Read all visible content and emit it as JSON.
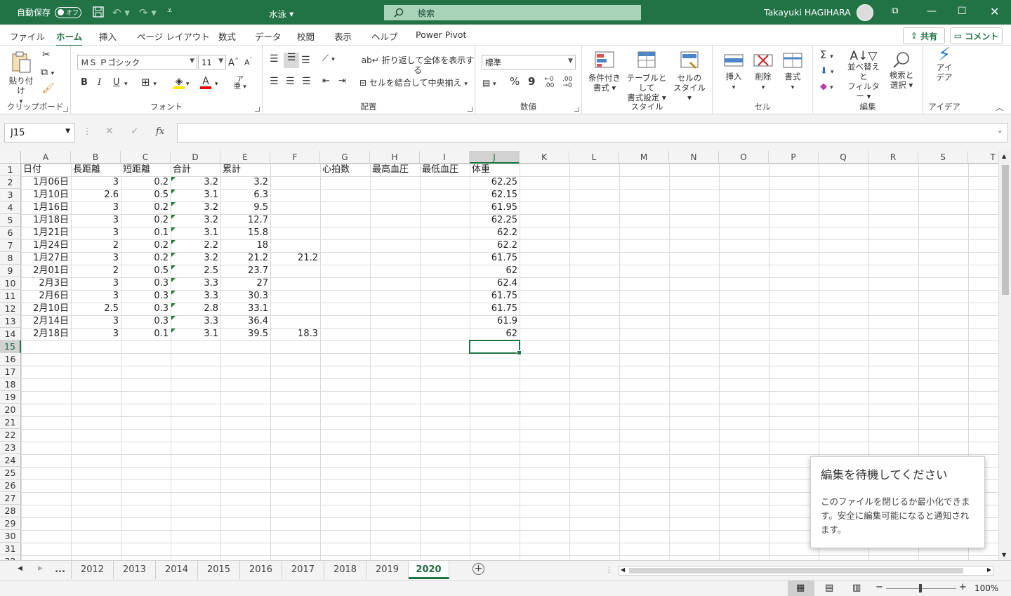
{
  "titlebar": {
    "autosave_label": "自動保存",
    "autosave_state": "オフ",
    "doc_title": "水泳",
    "search_placeholder": "検索",
    "user_name": "Takayuki HAGIHARA"
  },
  "menu": {
    "tabs": [
      "ファイル",
      "ホーム",
      "挿入",
      "ページ レイアウト",
      "数式",
      "データ",
      "校閲",
      "表示",
      "ヘルプ",
      "Power Pivot"
    ],
    "active": "ホーム",
    "share_label": "共有",
    "comment_label": "コメント"
  },
  "ribbon": {
    "clipboard": {
      "paste": "貼り付け",
      "label": "クリップボード"
    },
    "font": {
      "name": "ＭＳ Ｐゴシック",
      "size": "11",
      "label": "フォント",
      "bold": "B",
      "italic": "I",
      "underline": "U"
    },
    "alignment": {
      "wrap": "折り返して全体を表示する",
      "merge": "セルを結合して中央揃え",
      "label": "配置"
    },
    "number": {
      "format": "標準",
      "percent": "%",
      "comma": "9",
      "label": "数値"
    },
    "styles": {
      "conditional": [
        "条件付き",
        "書式"
      ],
      "table": [
        "テーブルとして",
        "書式設定"
      ],
      "cell": [
        "セルの",
        "スタイル"
      ],
      "label": "スタイル"
    },
    "cells": {
      "insert": "挿入",
      "delete": "削除",
      "format": "書式",
      "label": "セル"
    },
    "editing": {
      "sort": [
        "並べ替えと",
        "フィルター"
      ],
      "find": [
        "検索と",
        "選択"
      ],
      "label": "編集"
    },
    "ideas": {
      "name": [
        "アイ",
        "デア"
      ],
      "label": "アイデア"
    }
  },
  "formula_bar": {
    "name_box": "J15",
    "fx": "fx",
    "content": ""
  },
  "sheet": {
    "columns": [
      "A",
      "B",
      "C",
      "D",
      "E",
      "F",
      "G",
      "H",
      "I",
      "J",
      "K",
      "L",
      "M",
      "N",
      "O",
      "P",
      "Q",
      "R",
      "S",
      "T"
    ],
    "selected_col": "J",
    "selected_row": 15,
    "row_count": 32,
    "header_row": [
      "日付",
      "長距離",
      "短距離",
      "合計",
      "累計",
      "",
      "心拍数",
      "最高血圧",
      "最低血圧",
      "体重"
    ],
    "rows": [
      [
        "1月06日",
        "3",
        "0.2",
        "3.2",
        "3.2",
        "",
        "",
        "",
        "",
        "62.25"
      ],
      [
        "1月10日",
        "2.6",
        "0.5",
        "3.1",
        "6.3",
        "",
        "",
        "",
        "",
        "62.15"
      ],
      [
        "1月16日",
        "3",
        "0.2",
        "3.2",
        "9.5",
        "",
        "",
        "",
        "",
        "61.95"
      ],
      [
        "1月18日",
        "3",
        "0.2",
        "3.2",
        "12.7",
        "",
        "",
        "",
        "",
        "62.25"
      ],
      [
        "1月21日",
        "3",
        "0.1",
        "3.1",
        "15.8",
        "",
        "",
        "",
        "",
        "62.2"
      ],
      [
        "1月24日",
        "2",
        "0.2",
        "2.2",
        "18",
        "",
        "",
        "",
        "",
        "62.2"
      ],
      [
        "1月27日",
        "3",
        "0.2",
        "3.2",
        "21.2",
        "21.2",
        "",
        "",
        "",
        "61.75"
      ],
      [
        "2月01日",
        "2",
        "0.5",
        "2.5",
        "23.7",
        "",
        "",
        "",
        "",
        "62"
      ],
      [
        "2月3日",
        "3",
        "0.3",
        "3.3",
        "27",
        "",
        "",
        "",
        "",
        "62.4"
      ],
      [
        "2月6日",
        "3",
        "0.3",
        "3.3",
        "30.3",
        "",
        "",
        "",
        "",
        "61.75"
      ],
      [
        "2月10日",
        "2.5",
        "0.3",
        "2.8",
        "33.1",
        "",
        "",
        "",
        "",
        "61.75"
      ],
      [
        "2月14日",
        "3",
        "0.3",
        "3.3",
        "36.4",
        "",
        "",
        "",
        "",
        "61.9"
      ],
      [
        "2月18日",
        "3",
        "0.1",
        "3.1",
        "39.5",
        "18.3",
        "",
        "",
        "",
        "62"
      ]
    ]
  },
  "notification": {
    "title": "編集を待機してください",
    "body": "このファイルを閉じるか最小化できます。安全に編集可能になると通知されます。"
  },
  "sheet_tabs": {
    "more": "...",
    "tabs": [
      "2012",
      "2013",
      "2014",
      "2015",
      "2016",
      "2017",
      "2018",
      "2019",
      "2020"
    ],
    "active": "2020"
  },
  "status": {
    "zoom": "100%"
  }
}
